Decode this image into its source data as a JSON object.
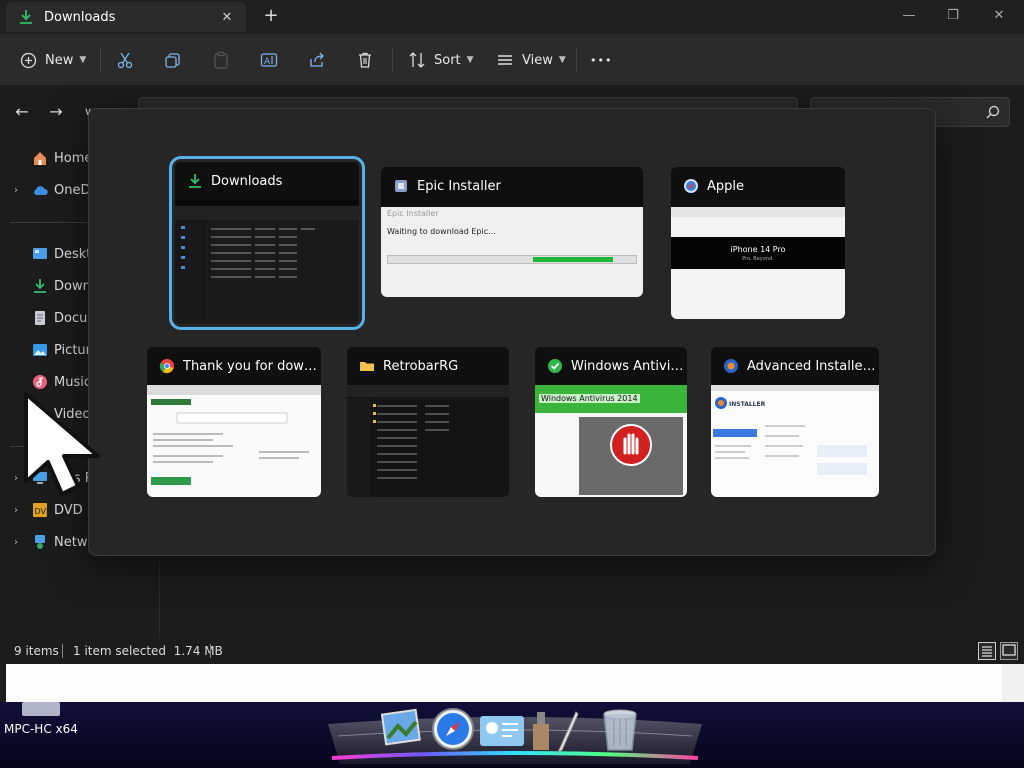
{
  "window": {
    "tab_title": "Downloads",
    "tab_close": "✕",
    "new_tab": "+",
    "minimize": "—",
    "restore": "❐",
    "close": "✕"
  },
  "toolbar": {
    "new_label": "New",
    "sort_label": "Sort",
    "view_label": "View",
    "more_label": "•••"
  },
  "sidebar": {
    "items": [
      {
        "label": "Home",
        "icon": "home-icon",
        "caret": ""
      },
      {
        "label": "OneDrive",
        "icon": "cloud-icon",
        "caret": "›"
      },
      {
        "label": "Desktop",
        "icon": "desktop-icon",
        "caret": ""
      },
      {
        "label": "Downloads",
        "icon": "download-icon",
        "caret": ""
      },
      {
        "label": "Documents",
        "icon": "document-icon",
        "caret": ""
      },
      {
        "label": "Pictures",
        "icon": "pictures-icon",
        "caret": ""
      },
      {
        "label": "Music",
        "icon": "music-icon",
        "caret": ""
      },
      {
        "label": "Videos",
        "icon": "videos-icon",
        "caret": ""
      },
      {
        "label": "This PC",
        "icon": "pc-icon",
        "caret": "›"
      },
      {
        "label": "DVD Drive",
        "icon": "dvd-icon",
        "caret": "›"
      },
      {
        "label": "Network",
        "icon": "network-icon",
        "caret": "›"
      }
    ]
  },
  "status": {
    "items_count": "9 items",
    "selection": "1 item selected  1.74 MB"
  },
  "taskbar": {
    "mpc_label": "MPC-HC x64"
  },
  "switcher": {
    "cards": [
      {
        "title": "Downloads",
        "icon": "download-icon"
      },
      {
        "title": "Epic Installer",
        "icon": "installer-icon"
      },
      {
        "title": "Apple",
        "icon": "safari-icon"
      },
      {
        "title": "Thank you for downlo...",
        "icon": "chrome-icon"
      },
      {
        "title": "RetrobarRG",
        "icon": "folder-icon"
      },
      {
        "title": "Windows Antiviru...",
        "icon": "checkmark-icon"
      },
      {
        "title": "Advanced Installer 1...",
        "icon": "advanced-installer-icon"
      }
    ],
    "thumbs": {
      "epic_window_title": "Epic Installer",
      "epic_status": "Waiting to download Epic...",
      "epic_progress": 0.6,
      "apple_headline": "iPhone 14 Pro",
      "apple_tagline": "Pro. Beyond.",
      "antivirus_title": "Windows Antivirus 2014",
      "advanced_brand": "INSTALLER"
    }
  },
  "colors": {
    "accent": "#5ab0e8",
    "download_green": "#2fbf6a",
    "antivirus_green": "#3bb43b",
    "progress_green": "#1fb43a"
  }
}
